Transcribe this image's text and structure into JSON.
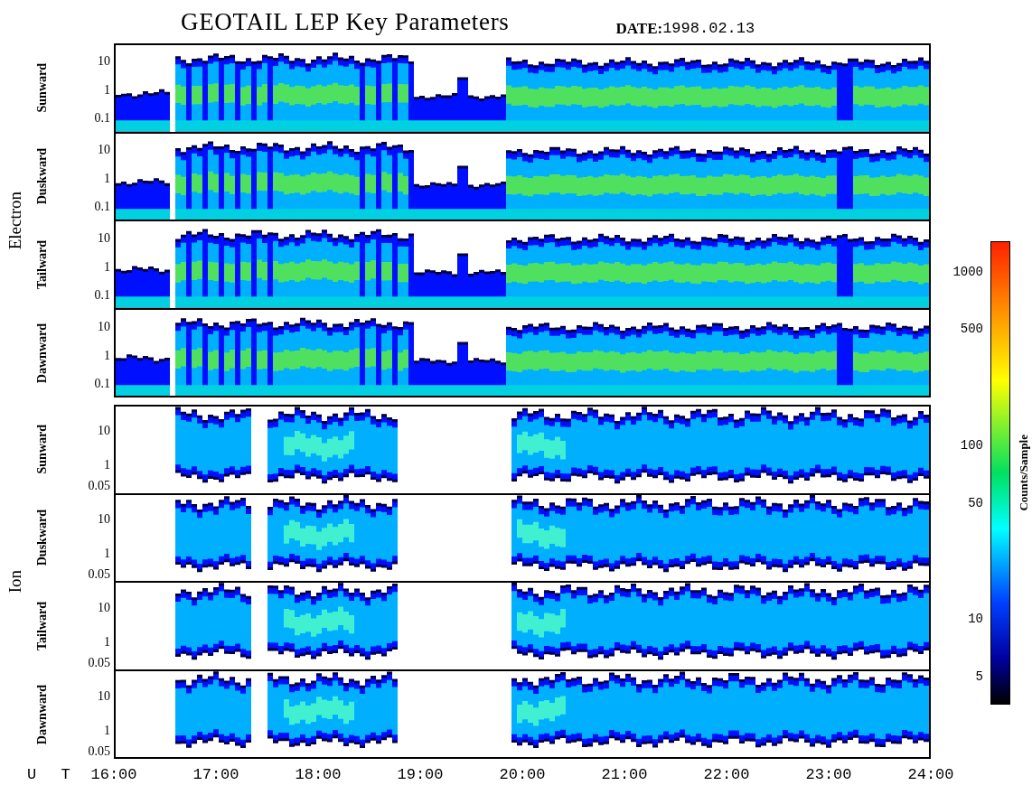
{
  "title": "GEOTAIL LEP Key Parameters",
  "date": {
    "label": "DATE:",
    "value": "1998.02.13"
  },
  "groups": [
    {
      "label": "Electron",
      "kind": "electron",
      "panels": [
        {
          "label": "Sunward",
          "yticks": [
            "10",
            "1",
            "0.1"
          ]
        },
        {
          "label": "Duskward",
          "yticks": [
            "10",
            "1",
            "0.1"
          ]
        },
        {
          "label": "Tailward",
          "yticks": [
            "10",
            "1",
            "0.1"
          ]
        },
        {
          "label": "Dawnward",
          "yticks": [
            "10",
            "1",
            "0.1"
          ]
        }
      ]
    },
    {
      "label": "Ion",
      "kind": "ion",
      "panels": [
        {
          "label": "Sunward",
          "yticks": [
            "10",
            "1",
            "0.05"
          ]
        },
        {
          "label": "Duskward",
          "yticks": [
            "10",
            "1",
            "0.05"
          ]
        },
        {
          "label": "Tailward",
          "yticks": [
            "10",
            "1",
            "0.05"
          ]
        },
        {
          "label": "Dawnward",
          "yticks": [
            "10",
            "1",
            "0.05"
          ]
        }
      ]
    }
  ],
  "x_axis": {
    "label": "U T",
    "ticks": [
      "16:00",
      "17:00",
      "18:00",
      "19:00",
      "20:00",
      "21:00",
      "22:00",
      "23:00",
      "24:00"
    ]
  },
  "colorbar": {
    "label": "Counts/Sample",
    "ticks": [
      "1000",
      "500",
      "100",
      "50",
      "10",
      "5"
    ]
  }
}
